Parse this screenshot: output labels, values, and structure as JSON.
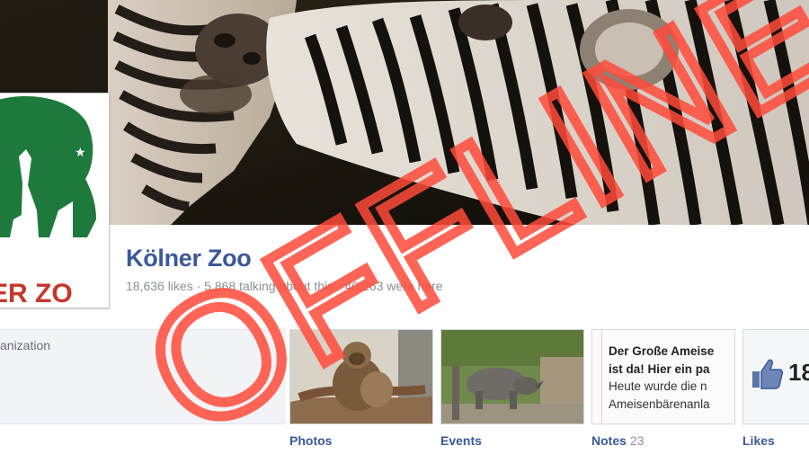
{
  "page": {
    "name": "Kölner Zoo",
    "stats": "18,636 likes · 5,868 talking about this · 40,263 were here",
    "category": "anization"
  },
  "profile_logo": {
    "text": "ER ZO",
    "brand_color": "#1e7a3c",
    "accent_red": "#c7362b"
  },
  "tiles": {
    "photos": {
      "label": "Photos"
    },
    "events": {
      "label": "Events"
    },
    "notes": {
      "label": "Notes",
      "count": "23",
      "title_line1": "Der Große Ameise",
      "title_line2": "ist da! Hier ein pa",
      "body_line1": "Heute wurde die n",
      "body_line2": "Ameisenbärenanla"
    },
    "likes": {
      "label": "Likes",
      "count": "18",
      "icon": "thumbs-up-icon"
    }
  },
  "overlay": {
    "stamp_text": "OFFLINE",
    "stamp_color": "#ff4a3a"
  },
  "colors": {
    "link_blue": "#3b5998",
    "muted_grey": "#8b8f96"
  }
}
